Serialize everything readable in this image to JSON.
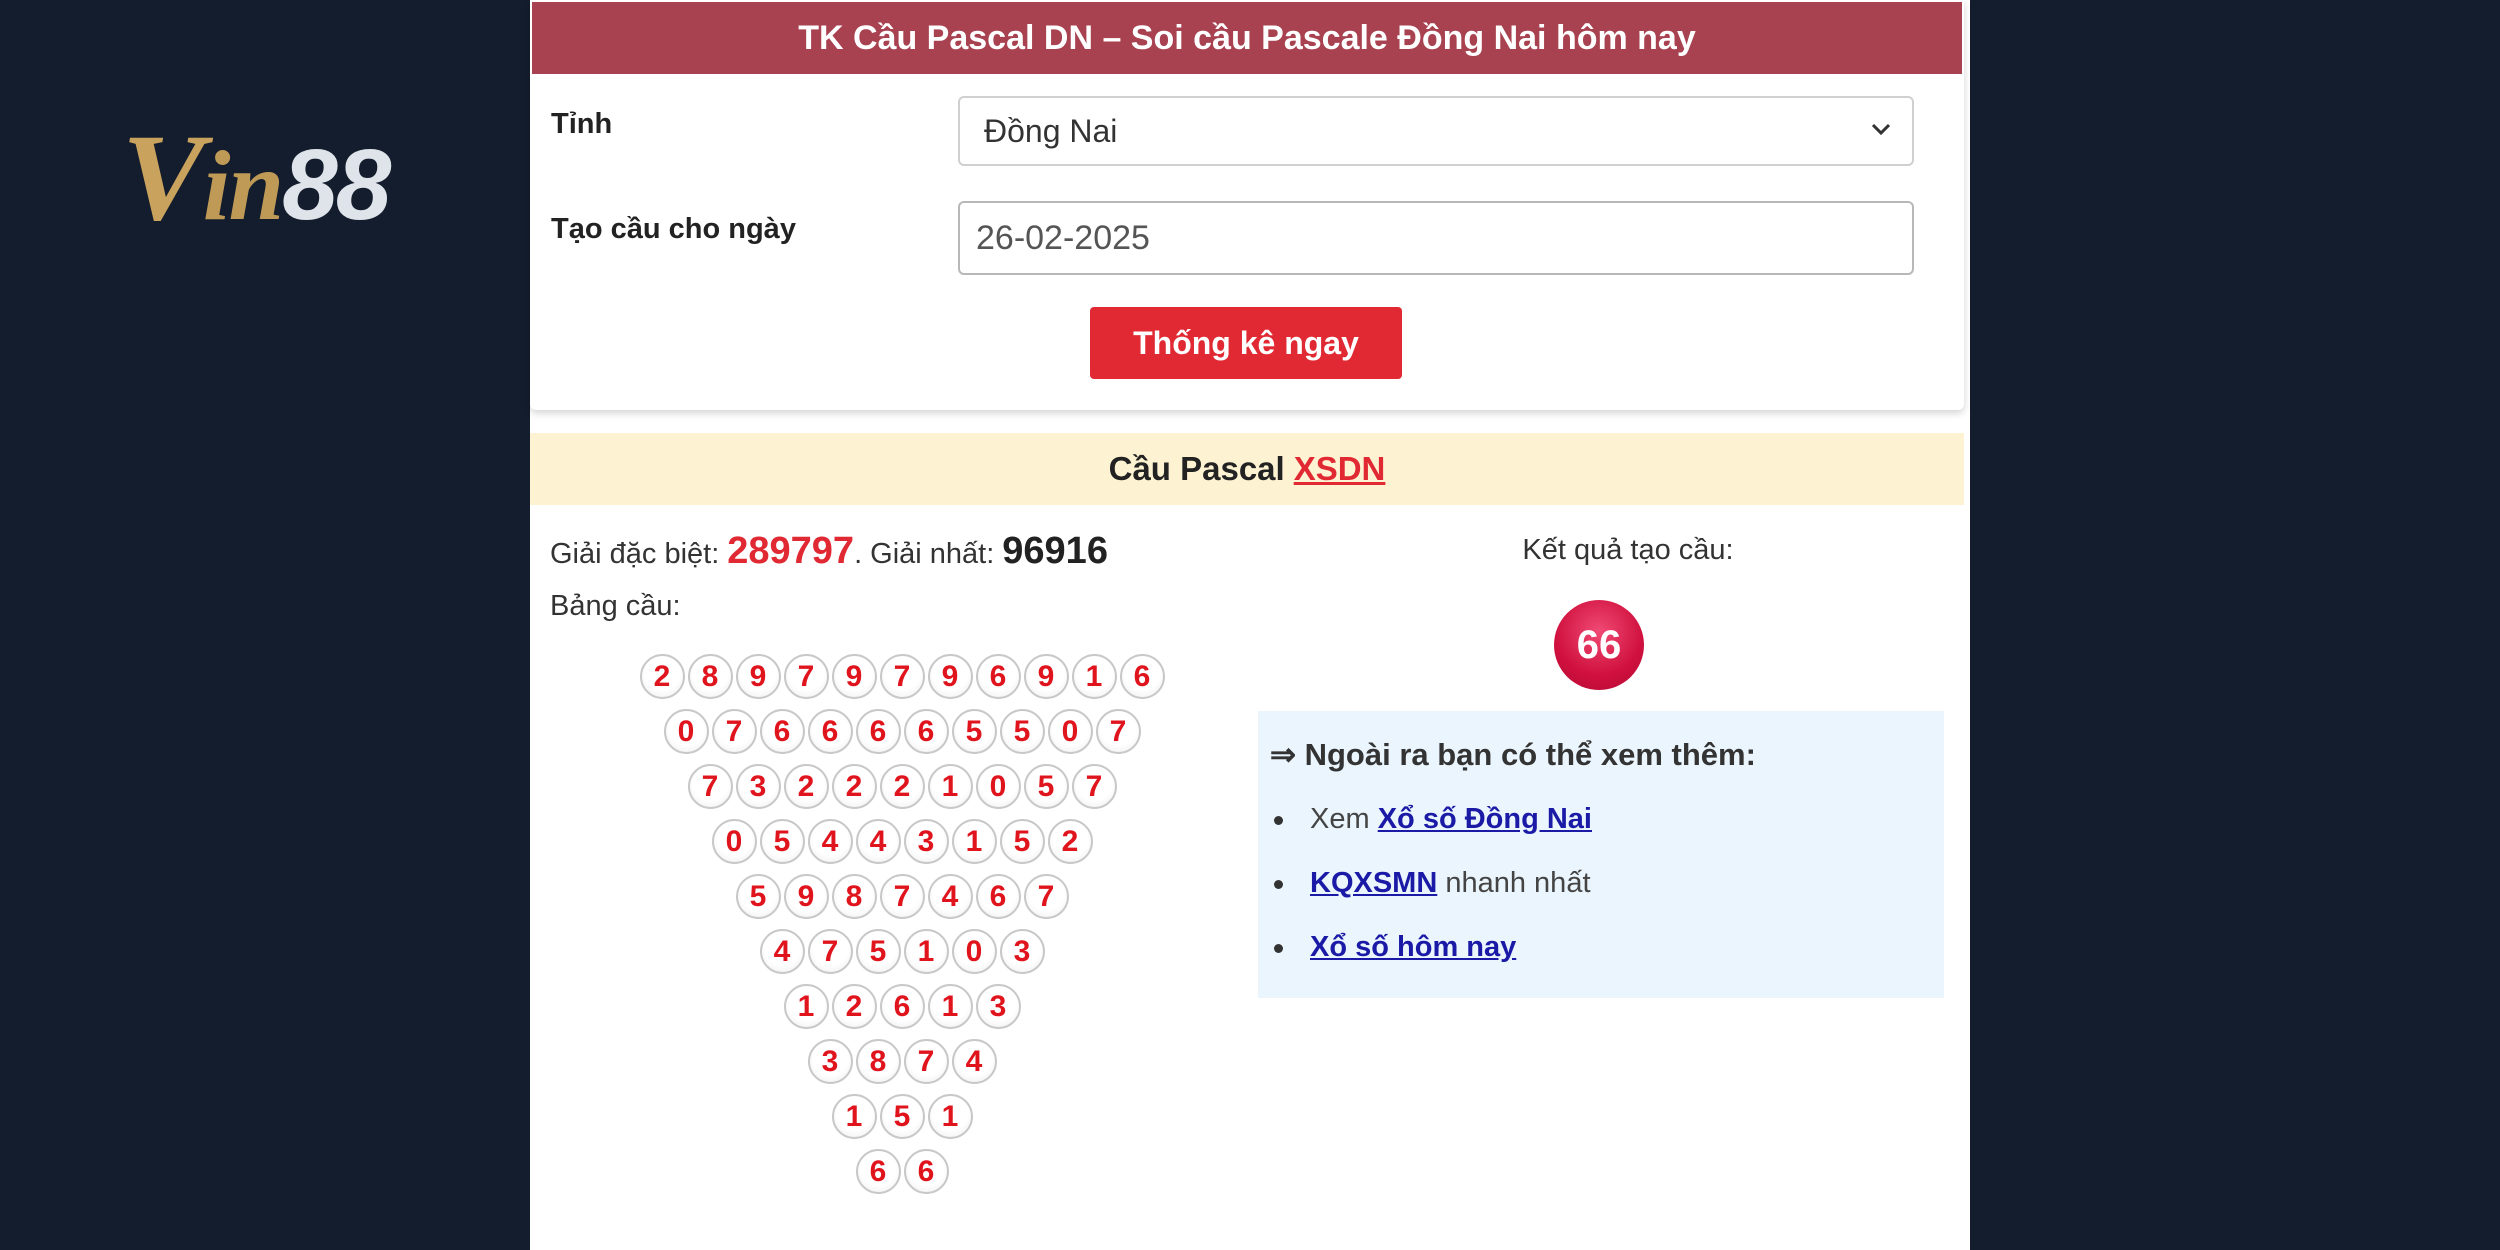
{
  "logo": {
    "text_v": "V",
    "text_in": "in",
    "text_88": "88"
  },
  "form": {
    "header": "TK Cầu Pascal DN – Soi cầu Pascale Đồng Nai hôm nay",
    "province_label": "Tỉnh",
    "province_value": "Đồng Nai",
    "date_label": "Tạo cầu cho ngày",
    "date_value": "26-02-2025",
    "submit_label": "Thống kê ngay"
  },
  "result": {
    "band_title": "Cầu Pascal",
    "band_link": "XSDN",
    "special_label": "Giải đặc biệt:",
    "special_value": "289797",
    "sep": ".",
    "first_label": "Giải nhất:",
    "first_value": "96916",
    "table_label": "Bảng cầu:",
    "pyramid": [
      [
        "2",
        "8",
        "9",
        "7",
        "9",
        "7",
        "9",
        "6",
        "9",
        "1",
        "6"
      ],
      [
        "0",
        "7",
        "6",
        "6",
        "6",
        "6",
        "5",
        "5",
        "0",
        "7"
      ],
      [
        "7",
        "3",
        "2",
        "2",
        "2",
        "1",
        "0",
        "5",
        "7"
      ],
      [
        "0",
        "5",
        "4",
        "4",
        "3",
        "1",
        "5",
        "2"
      ],
      [
        "5",
        "9",
        "8",
        "7",
        "4",
        "6",
        "7"
      ],
      [
        "4",
        "7",
        "5",
        "1",
        "0",
        "3"
      ],
      [
        "1",
        "2",
        "6",
        "1",
        "3"
      ],
      [
        "3",
        "8",
        "7",
        "4"
      ],
      [
        "1",
        "5",
        "1"
      ],
      [
        "6",
        "6"
      ]
    ],
    "outcome_label": "Kết quả tạo cầu:",
    "outcome_value": "66"
  },
  "more": {
    "title": "⇒ Ngoài ra bạn có thể xem thêm:",
    "item1_prefix": "Xem",
    "item1_link": "Xổ số Đồng Nai",
    "item2_link": "KQXSMN",
    "item2_suffix": "nhanh nhất",
    "item3_link": "Xổ số hôm nay"
  },
  "colors": {
    "header_bg": "#a84150",
    "accent_red": "#e02932",
    "band_bg": "#fdf3d3",
    "info_bg": "#eaf5fd",
    "page_bg": "#141d2d"
  }
}
